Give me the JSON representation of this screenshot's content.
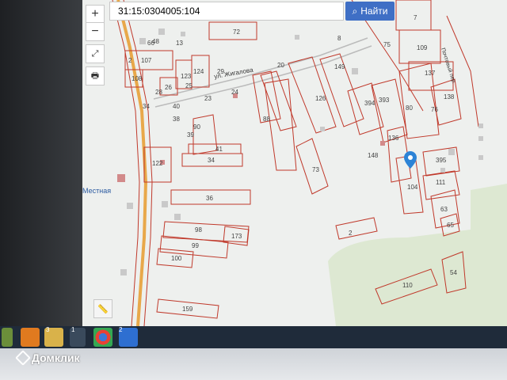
{
  "search": {
    "value": "31:15:0304005:104",
    "button_label": "Найти"
  },
  "controls": {
    "zoom_in": "+",
    "zoom_out": "−"
  },
  "streets": {
    "main": "ул. Жигалова",
    "side": "Почтовый пер."
  },
  "labels": {
    "p107": "107",
    "p108": "108",
    "p2": "2",
    "p66": "66",
    "p72": "72",
    "p124": "124",
    "p123": "123",
    "p28": "28",
    "p34a": "34",
    "p26": "26",
    "p25": "25",
    "p23": "23",
    "p29": "29",
    "p20": "20",
    "p24": "24",
    "p7": "7",
    "p109": "109",
    "p137": "137",
    "p138": "138",
    "p76": "76",
    "p80": "80",
    "p75": "75",
    "p149": "149",
    "p126": "126",
    "p394": "394",
    "p393": "393",
    "p88": "88",
    "p90": "90",
    "p41": "41",
    "p34": "34",
    "p122": "122",
    "p36": "36",
    "p73": "73",
    "p148": "148",
    "p136": "136",
    "p104": "104",
    "p395": "395",
    "p111": "111",
    "p63": "63",
    "p65": "65",
    "p98": "98",
    "p99": "99",
    "p173": "173",
    "p100": "100",
    "p2b": "2",
    "p110": "110",
    "p54": "54",
    "p159": "159",
    "p38": "38",
    "p40": "40",
    "p39": "39",
    "p48": "48",
    "p13": "13",
    "p8": "8"
  },
  "poi": {
    "station": "Местная"
  },
  "taskbar": {
    "folder_badge": "3",
    "other_badge": "1",
    "doc_badge": "2"
  },
  "watermark": {
    "brand": "Домклик"
  },
  "colors": {
    "parcel": "#c0392b",
    "road": "#e8a84a",
    "button": "#3f6fc5"
  }
}
